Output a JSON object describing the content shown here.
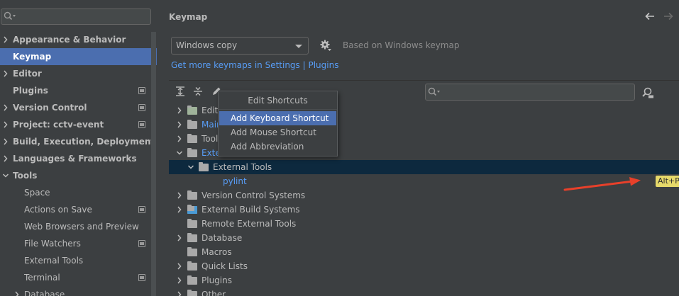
{
  "sidebar": {
    "search_placeholder": "",
    "items": [
      {
        "label": "Appearance & Behavior",
        "level": 0,
        "expandable": true,
        "expanded": false,
        "project_icon": false,
        "selected": false
      },
      {
        "label": "Keymap",
        "level": 0,
        "expandable": false,
        "expanded": false,
        "project_icon": false,
        "selected": true
      },
      {
        "label": "Editor",
        "level": 0,
        "expandable": true,
        "expanded": false,
        "project_icon": false,
        "selected": false
      },
      {
        "label": "Plugins",
        "level": 0,
        "expandable": false,
        "expanded": false,
        "project_icon": true,
        "selected": false
      },
      {
        "label": "Version Control",
        "level": 0,
        "expandable": true,
        "expanded": false,
        "project_icon": true,
        "selected": false
      },
      {
        "label": "Project: cctv-event",
        "level": 0,
        "expandable": true,
        "expanded": false,
        "project_icon": true,
        "selected": false
      },
      {
        "label": "Build, Execution, Deployment",
        "level": 0,
        "expandable": true,
        "expanded": false,
        "project_icon": false,
        "selected": false
      },
      {
        "label": "Languages & Frameworks",
        "level": 0,
        "expandable": true,
        "expanded": false,
        "project_icon": false,
        "selected": false
      },
      {
        "label": "Tools",
        "level": 0,
        "expandable": true,
        "expanded": true,
        "project_icon": false,
        "selected": false
      },
      {
        "label": "Space",
        "level": 1,
        "expandable": false,
        "expanded": false,
        "project_icon": false,
        "selected": false
      },
      {
        "label": "Actions on Save",
        "level": 1,
        "expandable": false,
        "expanded": false,
        "project_icon": true,
        "selected": false
      },
      {
        "label": "Web Browsers and Preview",
        "level": 1,
        "expandable": false,
        "expanded": false,
        "project_icon": false,
        "selected": false
      },
      {
        "label": "File Watchers",
        "level": 1,
        "expandable": false,
        "expanded": false,
        "project_icon": true,
        "selected": false
      },
      {
        "label": "External Tools",
        "level": 1,
        "expandable": false,
        "expanded": false,
        "project_icon": false,
        "selected": false
      },
      {
        "label": "Terminal",
        "level": 1,
        "expandable": false,
        "expanded": false,
        "project_icon": true,
        "selected": false
      },
      {
        "label": "Database",
        "level": 1,
        "expandable": true,
        "expanded": false,
        "project_icon": false,
        "selected": false
      }
    ]
  },
  "main": {
    "title": "Keymap",
    "keymap_value": "Windows copy",
    "based_on": "Based on Windows keymap",
    "more_keymaps_link": "Get more keymaps in Settings | Plugins",
    "filter_placeholder": "",
    "tree": [
      {
        "label": "Editor Actions",
        "indent": 0,
        "arrow": "right",
        "icon": "editor",
        "blue": false,
        "selected": false
      },
      {
        "label": "Main Menu",
        "indent": 0,
        "arrow": "right",
        "icon": "folder",
        "blue": true,
        "selected": false
      },
      {
        "label": "Tool Windows",
        "indent": 0,
        "arrow": "right",
        "icon": "folder",
        "blue": false,
        "selected": false
      },
      {
        "label": "External Tools",
        "indent": 0,
        "arrow": "down",
        "icon": "folder",
        "blue": true,
        "selected": false
      },
      {
        "label": "External Tools",
        "indent": 1,
        "arrow": "down",
        "icon": "folder",
        "blue": false,
        "selected": true
      },
      {
        "label": "pylint",
        "indent": 2,
        "arrow": "none",
        "icon": "none",
        "blue": true,
        "selected": false,
        "shortcut": "Alt+P"
      },
      {
        "label": "Version Control Systems",
        "indent": 0,
        "arrow": "right",
        "icon": "folder",
        "blue": false,
        "selected": false
      },
      {
        "label": "External Build Systems",
        "indent": 0,
        "arrow": "right",
        "icon": "build-folder",
        "blue": false,
        "selected": false
      },
      {
        "label": "Remote External Tools",
        "indent": 0,
        "arrow": "none",
        "icon": "folder",
        "blue": false,
        "selected": false
      },
      {
        "label": "Database",
        "indent": 0,
        "arrow": "right",
        "icon": "folder",
        "blue": false,
        "selected": false
      },
      {
        "label": "Macros",
        "indent": 0,
        "arrow": "none",
        "icon": "folder",
        "blue": false,
        "selected": false
      },
      {
        "label": "Quick Lists",
        "indent": 0,
        "arrow": "right",
        "icon": "folder",
        "blue": false,
        "selected": false
      },
      {
        "label": "Plugins",
        "indent": 0,
        "arrow": "right",
        "icon": "folder",
        "blue": false,
        "selected": false
      },
      {
        "label": "Other",
        "indent": 0,
        "arrow": "right",
        "icon": "folder",
        "blue": false,
        "selected": false
      }
    ]
  },
  "popup": {
    "title": "Edit Shortcuts",
    "items": [
      "Add Keyboard Shortcut",
      "Add Mouse Shortcut",
      "Add Abbreviation"
    ],
    "selected_index": 0
  },
  "colors": {
    "accent": "#4b6eaf",
    "link": "#589df6",
    "tree_selection": "#0d293e",
    "shortcut_badge": "#e6d96a",
    "annotation_arrow": "#e8402a"
  },
  "icons": {
    "left_search": "search-icon",
    "back": "arrow-left-icon",
    "forward": "arrow-right-icon",
    "settings": "gear-icon",
    "expand_all": "expand-all-icon",
    "collapse_all": "collapse-all-icon",
    "edit": "pencil-icon",
    "find_by_shortcut": "find-by-shortcut-icon"
  }
}
